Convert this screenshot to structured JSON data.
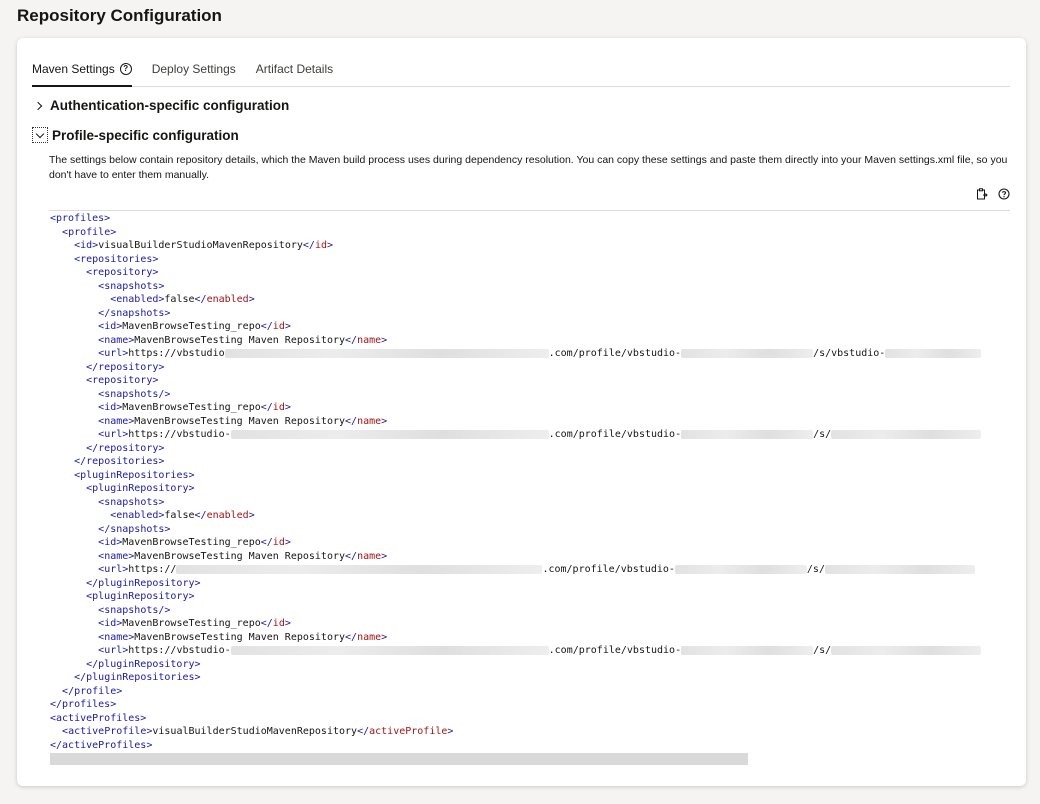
{
  "page": {
    "title": "Repository Configuration"
  },
  "tabs": [
    {
      "label": "Maven Settings",
      "active": true
    },
    {
      "label": "Deploy Settings",
      "active": false
    },
    {
      "label": "Artifact Details",
      "active": false
    }
  ],
  "sections": {
    "auth": {
      "label": "Authentication-specific configuration",
      "expanded": false
    },
    "profile": {
      "label": "Profile-specific configuration",
      "expanded": true
    }
  },
  "description": "The settings below contain repository details, which the Maven build process uses during dependency resolution. You can copy these settings and paste them directly into your Maven settings.xml file, so you don't have to enter them manually.",
  "toolbar_icons": [
    "copy-to-clipboard-icon",
    "help-icon"
  ],
  "colors": {
    "tag": "#1a1aa6",
    "tag_name_close": "#a31515",
    "accent": "#161513"
  },
  "code_lines": [
    [
      [
        "t",
        "<profiles>"
      ]
    ],
    [
      [
        "s",
        "  "
      ],
      [
        "t",
        "<profile>"
      ]
    ],
    [
      [
        "s",
        "    "
      ],
      [
        "t",
        "<id>"
      ],
      [
        "x",
        "visualBuilderStudioMavenRepository"
      ],
      [
        "t",
        "</"
      ],
      [
        "n",
        "id"
      ],
      [
        "t",
        ">"
      ]
    ],
    [
      [
        "s",
        "    "
      ],
      [
        "t",
        "<repositories>"
      ]
    ],
    [
      [
        "s",
        "      "
      ],
      [
        "t",
        "<repository>"
      ]
    ],
    [
      [
        "s",
        "        "
      ],
      [
        "t",
        "<snapshots>"
      ]
    ],
    [
      [
        "s",
        "          "
      ],
      [
        "t",
        "<enabled>"
      ],
      [
        "x",
        "false"
      ],
      [
        "t",
        "</"
      ],
      [
        "n",
        "enabled"
      ],
      [
        "t",
        ">"
      ]
    ],
    [
      [
        "s",
        "        "
      ],
      [
        "t",
        "</snapshots>"
      ]
    ],
    [
      [
        "s",
        "        "
      ],
      [
        "t",
        "<id>"
      ],
      [
        "x",
        "MavenBrowseTesting_repo"
      ],
      [
        "t",
        "</"
      ],
      [
        "n",
        "id"
      ],
      [
        "t",
        ">"
      ]
    ],
    [
      [
        "s",
        "        "
      ],
      [
        "t",
        "<name>"
      ],
      [
        "x",
        "MavenBrowseTesting Maven Repository"
      ],
      [
        "t",
        "</"
      ],
      [
        "n",
        "name"
      ],
      [
        "t",
        ">"
      ]
    ],
    [
      [
        "s",
        "        "
      ],
      [
        "t",
        "<url>"
      ],
      [
        "x",
        "https://vbstudio"
      ],
      [
        "b",
        "54"
      ],
      [
        "x",
        ".com/profile/vbstudio-"
      ],
      [
        "b",
        "22"
      ],
      [
        "x",
        "/s/vbstudio-"
      ],
      [
        "b",
        "16"
      ]
    ],
    [
      [
        "s",
        "      "
      ],
      [
        "t",
        "</repository>"
      ]
    ],
    [
      [
        "s",
        "      "
      ],
      [
        "t",
        "<repository>"
      ]
    ],
    [
      [
        "s",
        "        "
      ],
      [
        "t",
        "<snapshots/>"
      ]
    ],
    [
      [
        "s",
        "        "
      ],
      [
        "t",
        "<id>"
      ],
      [
        "x",
        "MavenBrowseTesting_repo"
      ],
      [
        "t",
        "</"
      ],
      [
        "n",
        "id"
      ],
      [
        "t",
        ">"
      ]
    ],
    [
      [
        "s",
        "        "
      ],
      [
        "t",
        "<name>"
      ],
      [
        "x",
        "MavenBrowseTesting Maven Repository"
      ],
      [
        "t",
        "</"
      ],
      [
        "n",
        "name"
      ],
      [
        "t",
        ">"
      ]
    ],
    [
      [
        "s",
        "        "
      ],
      [
        "t",
        "<url>"
      ],
      [
        "x",
        "https://vbstudio-"
      ],
      [
        "b",
        "53"
      ],
      [
        "x",
        ".com/profile/vbstudio-"
      ],
      [
        "b",
        "22"
      ],
      [
        "x",
        "/s/"
      ],
      [
        "b",
        "25"
      ]
    ],
    [
      [
        "s",
        "      "
      ],
      [
        "t",
        "</repository>"
      ]
    ],
    [
      [
        "s",
        "    "
      ],
      [
        "t",
        "</repositories>"
      ]
    ],
    [
      [
        "s",
        "    "
      ],
      [
        "t",
        "<pluginRepositories>"
      ]
    ],
    [
      [
        "s",
        "      "
      ],
      [
        "t",
        "<pluginRepository>"
      ]
    ],
    [
      [
        "s",
        "        "
      ],
      [
        "t",
        "<snapshots>"
      ]
    ],
    [
      [
        "s",
        "          "
      ],
      [
        "t",
        "<enabled>"
      ],
      [
        "x",
        "false"
      ],
      [
        "t",
        "</"
      ],
      [
        "n",
        "enabled"
      ],
      [
        "t",
        ">"
      ]
    ],
    [
      [
        "s",
        "        "
      ],
      [
        "t",
        "</snapshots>"
      ]
    ],
    [
      [
        "s",
        "        "
      ],
      [
        "t",
        "<id>"
      ],
      [
        "x",
        "MavenBrowseTesting_repo"
      ],
      [
        "t",
        "</"
      ],
      [
        "n",
        "id"
      ],
      [
        "t",
        ">"
      ]
    ],
    [
      [
        "s",
        "        "
      ],
      [
        "t",
        "<name>"
      ],
      [
        "x",
        "MavenBrowseTesting Maven Repository"
      ],
      [
        "t",
        "</"
      ],
      [
        "n",
        "name"
      ],
      [
        "t",
        ">"
      ]
    ],
    [
      [
        "s",
        "        "
      ],
      [
        "t",
        "<url>"
      ],
      [
        "x",
        "https://"
      ],
      [
        "b",
        "61"
      ],
      [
        "x",
        ".com/profile/vbstudio-"
      ],
      [
        "b",
        "22"
      ],
      [
        "x",
        "/s/"
      ],
      [
        "b",
        "25"
      ]
    ],
    [
      [
        "s",
        "      "
      ],
      [
        "t",
        "</pluginRepository>"
      ]
    ],
    [
      [
        "s",
        "      "
      ],
      [
        "t",
        "<pluginRepository>"
      ]
    ],
    [
      [
        "s",
        "        "
      ],
      [
        "t",
        "<snapshots/>"
      ]
    ],
    [
      [
        "s",
        "        "
      ],
      [
        "t",
        "<id>"
      ],
      [
        "x",
        "MavenBrowseTesting_repo"
      ],
      [
        "t",
        "</"
      ],
      [
        "n",
        "id"
      ],
      [
        "t",
        ">"
      ]
    ],
    [
      [
        "s",
        "        "
      ],
      [
        "t",
        "<name>"
      ],
      [
        "x",
        "MavenBrowseTesting Maven Repository"
      ],
      [
        "t",
        "</"
      ],
      [
        "n",
        "name"
      ],
      [
        "t",
        ">"
      ]
    ],
    [
      [
        "s",
        "        "
      ],
      [
        "t",
        "<url>"
      ],
      [
        "x",
        "https://vbstudio-"
      ],
      [
        "b",
        "53"
      ],
      [
        "x",
        ".com/profile/vbstudio-"
      ],
      [
        "b",
        "22"
      ],
      [
        "x",
        "/s/"
      ],
      [
        "b",
        "25"
      ]
    ],
    [
      [
        "s",
        "      "
      ],
      [
        "t",
        "</pluginRepository>"
      ]
    ],
    [
      [
        "s",
        "    "
      ],
      [
        "t",
        "</pluginRepositories>"
      ]
    ],
    [
      [
        "s",
        "  "
      ],
      [
        "t",
        "</profile>"
      ]
    ],
    [
      [
        "t",
        "</profiles>"
      ]
    ],
    [
      [
        "t",
        "<activeProfiles>"
      ]
    ],
    [
      [
        "s",
        "  "
      ],
      [
        "t",
        "<activeProfile>"
      ],
      [
        "x",
        "visualBuilderStudioMavenRepository"
      ],
      [
        "t",
        "</"
      ],
      [
        "n",
        "activeProfile"
      ],
      [
        "t",
        ">"
      ]
    ],
    [
      [
        "t",
        "</activeProfiles>"
      ]
    ]
  ]
}
